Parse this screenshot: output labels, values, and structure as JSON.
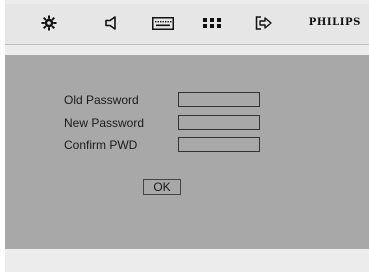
{
  "toolbar": {
    "icons": [
      "gear-icon",
      "speaker-icon",
      "keyboard-icon",
      "grid-icon",
      "exit-icon"
    ],
    "brand": "PHILIPS"
  },
  "form": {
    "fields": [
      {
        "label": "Old Password",
        "value": ""
      },
      {
        "label": "New Password",
        "value": ""
      },
      {
        "label": "Confirm PWD",
        "value": ""
      }
    ],
    "ok_label": "OK"
  },
  "colors": {
    "panel_bg": "#a8a8a8",
    "toolbar_bg": "#e6e6e6",
    "footer_bg": "#ececec"
  }
}
